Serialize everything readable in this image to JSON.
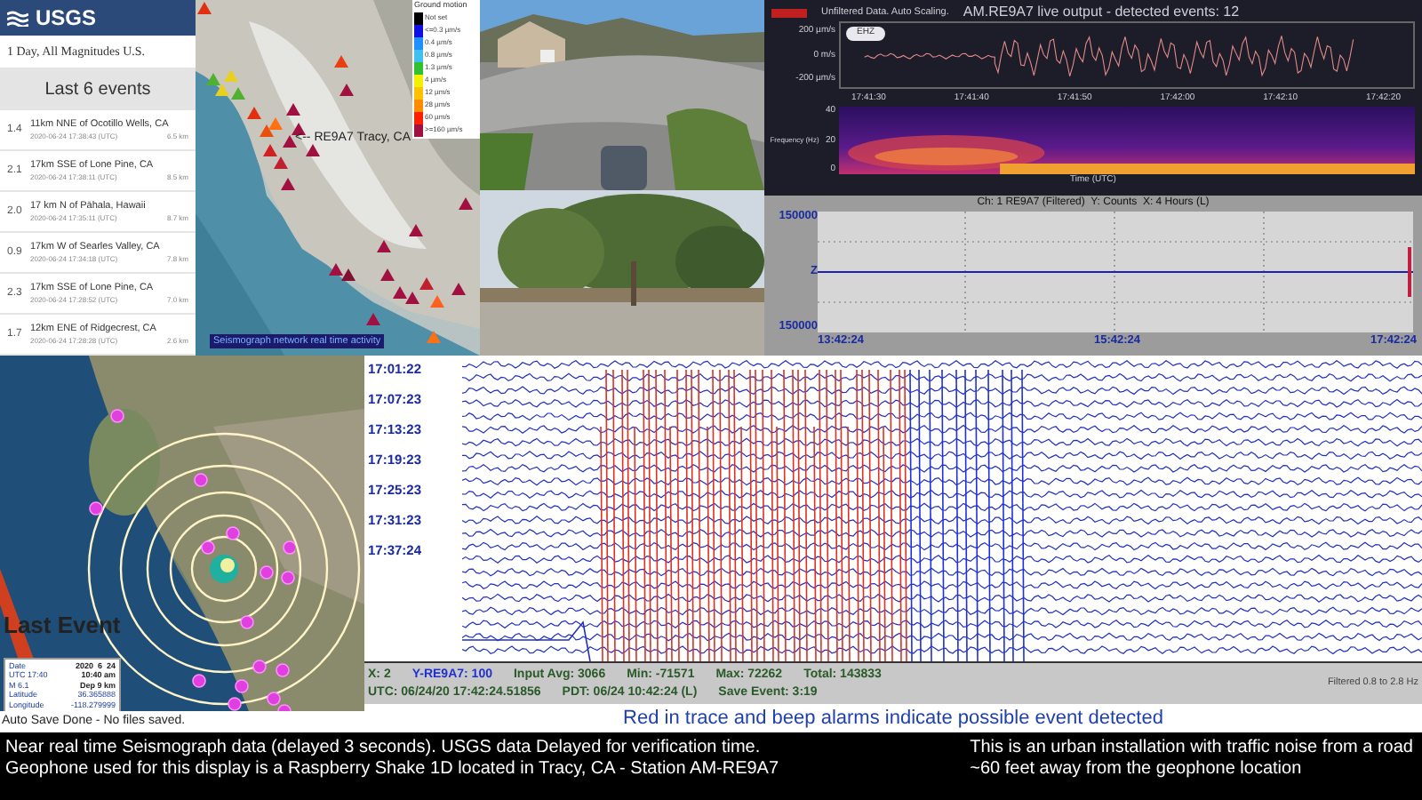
{
  "usgs": {
    "logo": "USGS",
    "title": "1 Day, All Magnitudes U.S.",
    "subtitle": "Last 6 events",
    "events": [
      {
        "mag": "1.4",
        "place": "11km NNE of Ocotillo Wells, CA",
        "time": "2020-06-24 17:38:43 (UTC)",
        "depth": "6.5 km"
      },
      {
        "mag": "2.1",
        "place": "17km SSE of Lone Pine, CA",
        "time": "2020-06-24 17:38:11 (UTC)",
        "depth": "8.5 km"
      },
      {
        "mag": "2.0",
        "place": "17 km N of Pāhala, Hawaii",
        "time": "2020-06-24 17:35:11 (UTC)",
        "depth": "8.7 km"
      },
      {
        "mag": "0.9",
        "place": "17km W of Searles Valley, CA",
        "time": "2020-06-24 17:34:18 (UTC)",
        "depth": "7.8 km"
      },
      {
        "mag": "2.3",
        "place": "17km SSE of Lone Pine, CA",
        "time": "2020-06-24 17:28:52 (UTC)",
        "depth": "7.0 km"
      },
      {
        "mag": "1.7",
        "place": "12km ENE of Ridgecrest, CA",
        "time": "2020-06-24 17:28:28 (UTC)",
        "depth": "2.6 km"
      }
    ]
  },
  "network_map": {
    "station_label": "<-- RE9A7 Tracy, CA",
    "caption": "Seismograph network real time activity",
    "legend": {
      "title": "Ground motion",
      "levels": [
        {
          "label": "Not set",
          "color": "#000000"
        },
        {
          "label": "<=0.3 µm/s",
          "color": "#1010e0"
        },
        {
          "label": "0.4 µm/s",
          "color": "#1e90ff"
        },
        {
          "label": "0.8 µm/s",
          "color": "#40c0f0"
        },
        {
          "label": "1.3 µm/s",
          "color": "#30c030"
        },
        {
          "label": "4 µm/s",
          "color": "#f0f000"
        },
        {
          "label": "12 µm/s",
          "color": "#ffc000"
        },
        {
          "label": "28 µm/s",
          "color": "#ff8c00"
        },
        {
          "label": "60 µm/s",
          "color": "#ff2000"
        },
        {
          "label": ">=160 µm/s",
          "color": "#a01040"
        }
      ]
    }
  },
  "live_output": {
    "mode": "Unfiltered Data. Auto Scaling.",
    "title": "AM.RE9A7 live output - detected events: 12",
    "channel": "EHZ",
    "yticks": [
      "200 µm/s",
      "0 m/s",
      "-200 µm/s"
    ],
    "xticks": [
      "17:41:30",
      "17:41:40",
      "17:41:50",
      "17:42:00",
      "17:42:10",
      "17:42:20"
    ],
    "spectrogram": {
      "ylabel": "Frequency (Hz)",
      "yticks": [
        "40",
        "20",
        "0"
      ],
      "xlabel": "Time (UTC)"
    }
  },
  "helicorder": {
    "title": "Ch: 1 RE9A7 (Filtered)  Y: Counts  X: 4 Hours (L)",
    "yticks": [
      "150000",
      "Z",
      "150000"
    ],
    "xticks": [
      "13:42:24",
      "15:42:24",
      "17:42:24"
    ]
  },
  "seismogram": {
    "row_times": [
      "17:01:22",
      "17:07:23",
      "17:13:23",
      "17:19:23",
      "17:25:23",
      "17:31:23",
      "17:37:24"
    ],
    "stats": [
      [
        "X: 2",
        "Y-RE9A7: 100",
        "Input Avg: 3066",
        "Min: -71571",
        "Max: 72262",
        "Total: 143833"
      ],
      [
        "UTC: 06/24/20 17:42:24.51856",
        "PDT: 06/24 10:42:24 (L)",
        "Save Event: 3:19"
      ]
    ],
    "filter": "Filtered 0.8 to 2.8 Hz",
    "alert": "Red in trace and beep alarms indicate possible event detected"
  },
  "last_event": {
    "heading": "Last Event",
    "rows": [
      [
        "Date",
        "2020  6  24"
      ],
      [
        "UTC 17:40",
        "10:40 am"
      ],
      [
        "M 6.1",
        "Dep 9 km"
      ],
      [
        "Latitude",
        "36.365888"
      ],
      [
        "Longitude",
        "-118.279999"
      ]
    ]
  },
  "status": "Auto Save Done - No files saved.",
  "footer": {
    "left": [
      "Near real time Seismograph data (delayed 3 seconds). USGS data Delayed for verification time.",
      "Geophone used for this display is a Raspberry Shake 1D located in Tracy, CA - Station AM-RE9A7"
    ],
    "right": [
      "This is an urban installation with traffic noise from a road",
      "~60 feet away from the geophone location"
    ]
  }
}
